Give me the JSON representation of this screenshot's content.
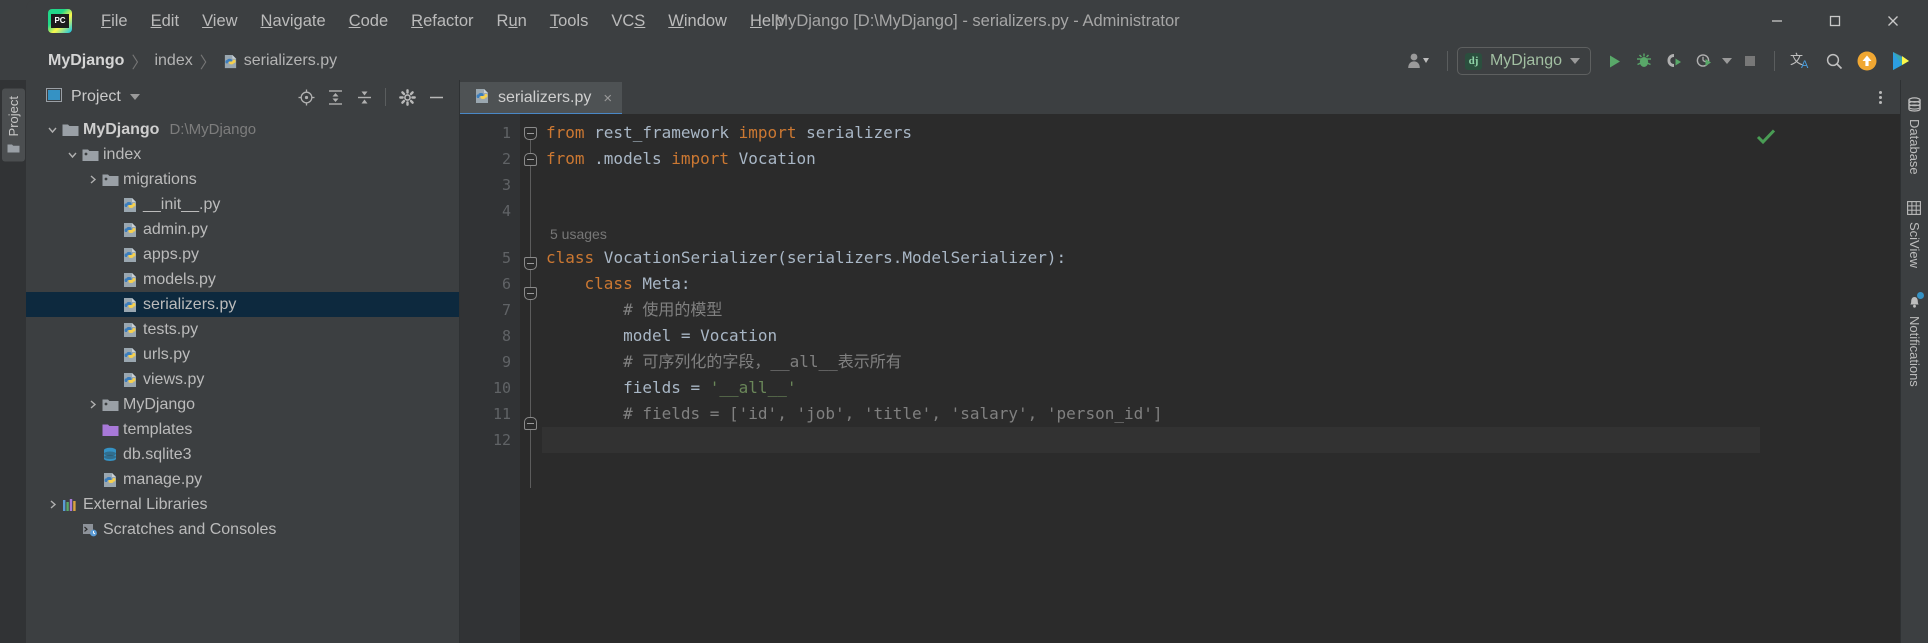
{
  "window": {
    "title": "MyDjango [D:\\MyDjango] - serializers.py - Administrator",
    "minimize_label": "Minimize",
    "maximize_label": "Maximize",
    "close_label": "Close"
  },
  "menubar": {
    "items": [
      {
        "label": "File",
        "mnemonic": "F"
      },
      {
        "label": "Edit",
        "mnemonic": "E"
      },
      {
        "label": "View",
        "mnemonic": "V"
      },
      {
        "label": "Navigate",
        "mnemonic": "N"
      },
      {
        "label": "Code",
        "mnemonic": "C"
      },
      {
        "label": "Refactor",
        "mnemonic": "R"
      },
      {
        "label": "Run",
        "mnemonic": "u"
      },
      {
        "label": "Tools",
        "mnemonic": "T"
      },
      {
        "label": "VCS",
        "mnemonic": "S"
      },
      {
        "label": "Window",
        "mnemonic": "W"
      },
      {
        "label": "Help",
        "mnemonic": "H"
      }
    ]
  },
  "breadcrumb": {
    "items": [
      {
        "label": "MyDjango",
        "icon": "none"
      },
      {
        "label": "index",
        "icon": "none"
      },
      {
        "label": "serializers.py",
        "icon": "python-file-icon"
      }
    ],
    "separator": "〉"
  },
  "toolbar": {
    "account_label": "Account",
    "run_config": {
      "label": "MyDjango",
      "icon": "django-icon"
    },
    "buttons": [
      {
        "name": "run-button",
        "label": "Run"
      },
      {
        "name": "debug-button",
        "label": "Debug"
      },
      {
        "name": "run-with-coverage-button",
        "label": "Run with Coverage"
      },
      {
        "name": "profile-button",
        "label": "Profile"
      },
      {
        "name": "stop-button",
        "label": "Stop"
      },
      {
        "name": "translate-button",
        "label": "Translate"
      },
      {
        "name": "search-everywhere-button",
        "label": "Search Everywhere"
      },
      {
        "name": "update-project-button",
        "label": "Update Project"
      },
      {
        "name": "ide-feature-button",
        "label": "IDE Features"
      }
    ]
  },
  "left_strip": {
    "tabs": [
      {
        "label": "Project",
        "icon": "project-folder-icon"
      }
    ]
  },
  "project_panel": {
    "title": "Project",
    "tools": [
      {
        "name": "select-opened-file-button",
        "label": "Select Opened File"
      },
      {
        "name": "expand-all-button",
        "label": "Expand All"
      },
      {
        "name": "collapse-all-button",
        "label": "Collapse All"
      },
      {
        "name": "settings-button",
        "label": "Settings"
      },
      {
        "name": "hide-button",
        "label": "Hide"
      }
    ],
    "tree": [
      {
        "label": "MyDjango",
        "path": "D:\\MyDjango",
        "indent": 0,
        "arrow": "down",
        "icon": "folder-module-icon",
        "bold": true,
        "selected": false
      },
      {
        "label": "index",
        "path": "",
        "indent": 1,
        "arrow": "down",
        "icon": "folder-source-icon",
        "bold": false,
        "selected": false
      },
      {
        "label": "migrations",
        "path": "",
        "indent": 2,
        "arrow": "right",
        "icon": "folder-source-icon",
        "bold": false,
        "selected": false
      },
      {
        "label": "__init__.py",
        "path": "",
        "indent": 3,
        "arrow": "none",
        "icon": "python-file-icon",
        "bold": false,
        "selected": false
      },
      {
        "label": "admin.py",
        "path": "",
        "indent": 3,
        "arrow": "none",
        "icon": "python-file-icon",
        "bold": false,
        "selected": false
      },
      {
        "label": "apps.py",
        "path": "",
        "indent": 3,
        "arrow": "none",
        "icon": "python-file-icon",
        "bold": false,
        "selected": false
      },
      {
        "label": "models.py",
        "path": "",
        "indent": 3,
        "arrow": "none",
        "icon": "python-file-icon",
        "bold": false,
        "selected": false
      },
      {
        "label": "serializers.py",
        "path": "",
        "indent": 3,
        "arrow": "none",
        "icon": "python-file-icon",
        "bold": false,
        "selected": true
      },
      {
        "label": "tests.py",
        "path": "",
        "indent": 3,
        "arrow": "none",
        "icon": "python-file-icon",
        "bold": false,
        "selected": false
      },
      {
        "label": "urls.py",
        "path": "",
        "indent": 3,
        "arrow": "none",
        "icon": "python-file-icon",
        "bold": false,
        "selected": false
      },
      {
        "label": "views.py",
        "path": "",
        "indent": 3,
        "arrow": "none",
        "icon": "python-file-icon",
        "bold": false,
        "selected": false
      },
      {
        "label": "MyDjango",
        "path": "",
        "indent": 2,
        "arrow": "right",
        "icon": "folder-source-icon",
        "bold": false,
        "selected": false
      },
      {
        "label": "templates",
        "path": "",
        "indent": 2,
        "arrow": "none",
        "icon": "folder-templates-icon",
        "bold": false,
        "selected": false
      },
      {
        "label": "db.sqlite3",
        "path": "",
        "indent": 2,
        "arrow": "none",
        "icon": "database-file-icon",
        "bold": false,
        "selected": false
      },
      {
        "label": "manage.py",
        "path": "",
        "indent": 2,
        "arrow": "none",
        "icon": "python-file-icon",
        "bold": false,
        "selected": false
      },
      {
        "label": "External Libraries",
        "path": "",
        "indent": 0,
        "arrow": "right",
        "icon": "libraries-icon",
        "bold": false,
        "selected": false
      },
      {
        "label": "Scratches and Consoles",
        "path": "",
        "indent": 1,
        "arrow": "none",
        "icon": "scratches-icon",
        "bold": false,
        "selected": false
      }
    ]
  },
  "editor": {
    "tabs": [
      {
        "label": "serializers.py",
        "icon": "python-file-icon",
        "active": true,
        "close_label": "×"
      }
    ],
    "options_label": "Options",
    "inspection_status": "ok",
    "usages_hint": {
      "line_after": 4,
      "text": "5 usages"
    },
    "lines": [
      {
        "n": 1,
        "tokens": [
          {
            "t": "from",
            "c": "kw"
          },
          {
            "t": " rest_framework ",
            "c": "plain"
          },
          {
            "t": "import",
            "c": "kw"
          },
          {
            "t": " serializers",
            "c": "plain"
          }
        ]
      },
      {
        "n": 2,
        "tokens": [
          {
            "t": "from",
            "c": "kw"
          },
          {
            "t": " .models ",
            "c": "plain"
          },
          {
            "t": "import",
            "c": "kw"
          },
          {
            "t": " Vocation",
            "c": "plain"
          }
        ]
      },
      {
        "n": 3,
        "tokens": []
      },
      {
        "n": 4,
        "tokens": []
      },
      {
        "n": 5,
        "tokens": [
          {
            "t": "class",
            "c": "kw"
          },
          {
            "t": " VocationSerializer(serializers.ModelSerializer):",
            "c": "plain"
          }
        ]
      },
      {
        "n": 6,
        "tokens": [
          {
            "t": "    ",
            "c": "plain"
          },
          {
            "t": "class",
            "c": "kw"
          },
          {
            "t": " Meta:",
            "c": "plain"
          }
        ]
      },
      {
        "n": 7,
        "tokens": [
          {
            "t": "        # 使用的模型",
            "c": "cmt"
          }
        ]
      },
      {
        "n": 8,
        "tokens": [
          {
            "t": "        model = Vocation",
            "c": "plain"
          }
        ]
      },
      {
        "n": 9,
        "tokens": [
          {
            "t": "        # 可序列化的字段，__all__表示所有",
            "c": "cmt"
          }
        ]
      },
      {
        "n": 10,
        "tokens": [
          {
            "t": "        fields = ",
            "c": "plain"
          },
          {
            "t": "'__all__'",
            "c": "str"
          }
        ]
      },
      {
        "n": 11,
        "tokens": [
          {
            "t": "        # fields = ['id', 'job', 'title', 'salary', 'person_id']",
            "c": "cmt"
          }
        ]
      },
      {
        "n": 12,
        "tokens": []
      }
    ]
  },
  "right_strip": {
    "tabs": [
      {
        "label": "Database",
        "icon": "database-icon",
        "badge": false
      },
      {
        "label": "SciView",
        "icon": "grid-icon",
        "badge": false
      },
      {
        "label": "Notifications",
        "icon": "bell-icon",
        "badge": true
      }
    ]
  },
  "colors": {
    "accent_blue": "#4a88c7",
    "selection_blue": "#0d293e",
    "keyword_orange": "#cc7832",
    "string_green": "#6a8759",
    "comment_gray": "#808080",
    "editor_bg": "#2b2b2b",
    "panel_bg": "#3c3f41",
    "run_green": "#59a869",
    "update_orange": "#f0a732"
  }
}
